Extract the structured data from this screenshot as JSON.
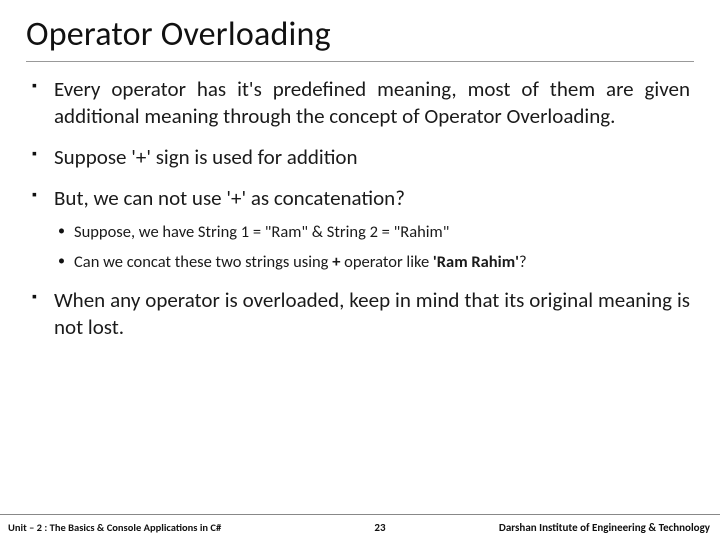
{
  "title": "Operator Overloading",
  "bullets": {
    "b1": "Every operator has it's predefined meaning, most of them are given additional meaning through the concept of Operator Overloading.",
    "b2": "Suppose '+' sign is used for addition",
    "b3": "But, we can not use '+' as concatenation?",
    "b3_sub1": "Suppose, we have String 1 = \"Ram\" & String 2 = \"Rahim\"",
    "b3_sub2_a": "Can we concat these two strings using ",
    "b3_sub2_plus": "+",
    "b3_sub2_b": " operator like ",
    "b3_sub2_c": "'Ram Rahim'",
    "b3_sub2_d": "?",
    "b4": "When any operator is overloaded, keep in mind that its original meaning is not lost."
  },
  "footer": {
    "left": "Unit – 2 : The Basics & Console Applications in C#",
    "page": "23",
    "right": "Darshan Institute of Engineering & Technology"
  }
}
